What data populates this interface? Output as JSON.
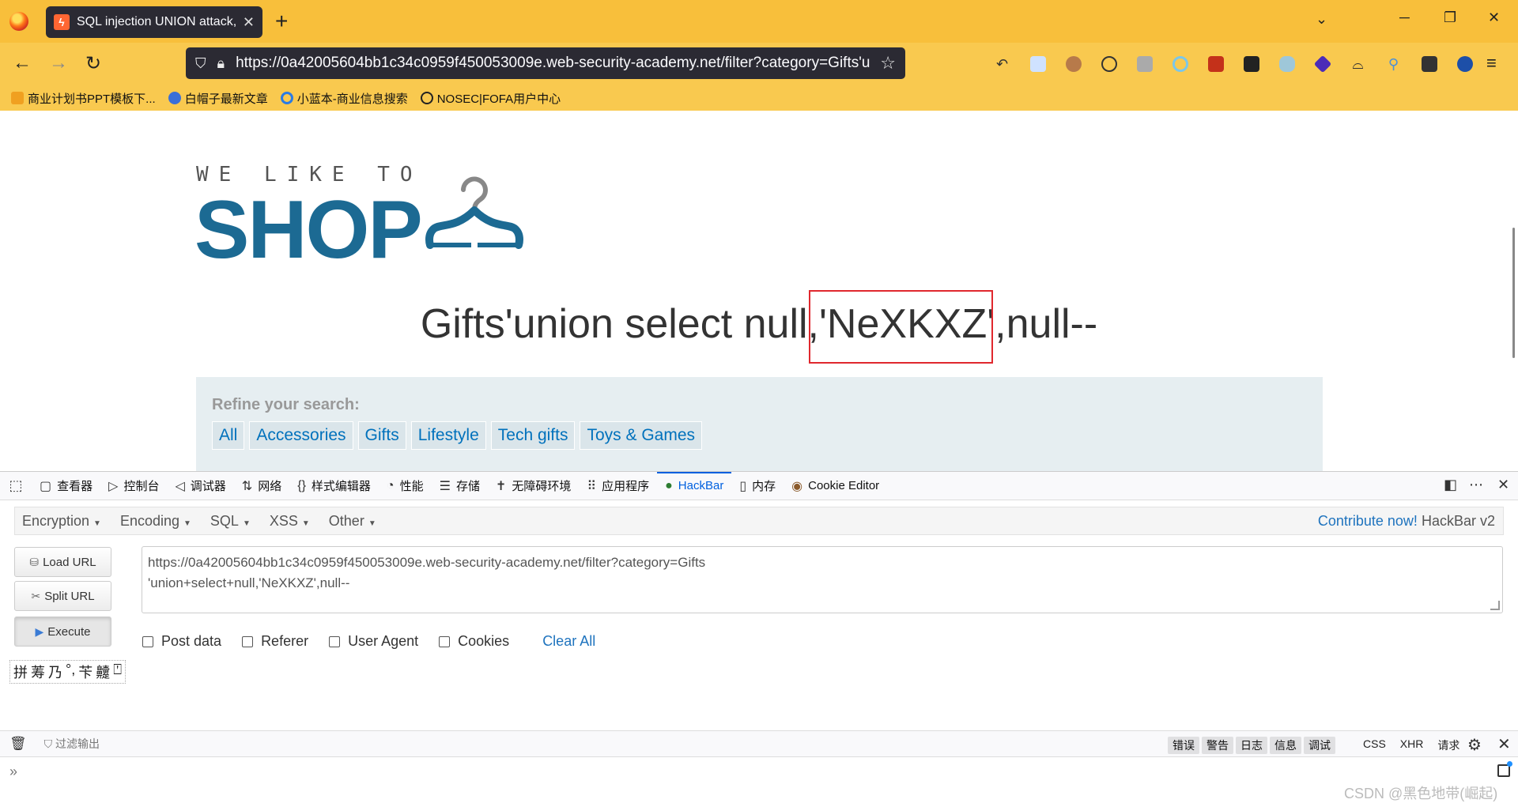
{
  "browser": {
    "tab_title": "SQL injection UNION attack, ",
    "tab_close": "✕",
    "new_tab": "+",
    "url": "https://0a42005604bb1c34c0959f450053009e.web-security-academy.net/filter?category=Gifts'u",
    "bookmarks": [
      {
        "label": "商业计划书PPT模板下...",
        "color": "#f0a020"
      },
      {
        "label": "白帽子最新文章",
        "color": "#3b6fd8"
      },
      {
        "label": "小蓝本-商业信息搜索",
        "color": "#2a7be4"
      },
      {
        "label": "NOSEC|FOFA用户中心",
        "color": "#222222"
      }
    ]
  },
  "page": {
    "logo_top": "WE LIKE TO",
    "logo_shop": "SHOP",
    "headline_pre": "Gifts'union select null,",
    "headline_mid": "'NeXKXZ'",
    "headline_post": ",null--",
    "refine_title": "Refine your search:",
    "filters": [
      "All",
      "Accessories",
      "Gifts",
      "Lifestyle",
      "Tech gifts",
      "Toys & Games"
    ],
    "colors": {
      "brand": "#1c6a93",
      "link": "#0071bc",
      "highlight": "#e0282e"
    }
  },
  "devtools": {
    "tabs": [
      {
        "icon": "▢",
        "label": "查看器"
      },
      {
        "icon": "▷",
        "label": "控制台"
      },
      {
        "icon": "◁",
        "label": "调试器"
      },
      {
        "icon": "⇅",
        "label": "网络"
      },
      {
        "icon": "{}",
        "label": "样式编辑器"
      },
      {
        "icon": "◔",
        "label": "性能"
      },
      {
        "icon": "☰",
        "label": "存储"
      },
      {
        "icon": "✝",
        "label": "无障碍环境"
      },
      {
        "icon": "⠿",
        "label": "应用程序"
      },
      {
        "icon": "●",
        "label": "HackBar"
      },
      {
        "icon": "▯",
        "label": "内存"
      },
      {
        "icon": "◉",
        "label": "Cookie Editor"
      }
    ],
    "active_tab": "HackBar"
  },
  "hackbar": {
    "menu": [
      "Encryption",
      "Encoding",
      "SQL",
      "XSS",
      "Other"
    ],
    "contribute_link": "Contribute now!",
    "version": "HackBar v2",
    "load_url": "Load URL",
    "split_url": "Split URL",
    "execute": "Execute",
    "url_value": "https://0a42005604bb1c34c0959f450053009e.web-security-academy.net/filter?category=Gifts\n'union+select+null,'NeXKXZ',null--",
    "checkboxes": [
      "Post data",
      "Referer",
      "User Agent",
      "Cookies"
    ],
    "clear_all": "Clear All",
    "ime_glyphs": [
      "拼",
      "䓓",
      "乃",
      "°,",
      "苄",
      "䶑",
      "⍞"
    ]
  },
  "console": {
    "filter_placeholder": "过滤输出",
    "levels": [
      "错误",
      "警告",
      "日志",
      "信息",
      "调试"
    ],
    "net_filters": [
      "CSS",
      "XHR",
      "请求"
    ],
    "prompt": "»"
  },
  "watermark": "CSDN @黑色地带(崛起)"
}
